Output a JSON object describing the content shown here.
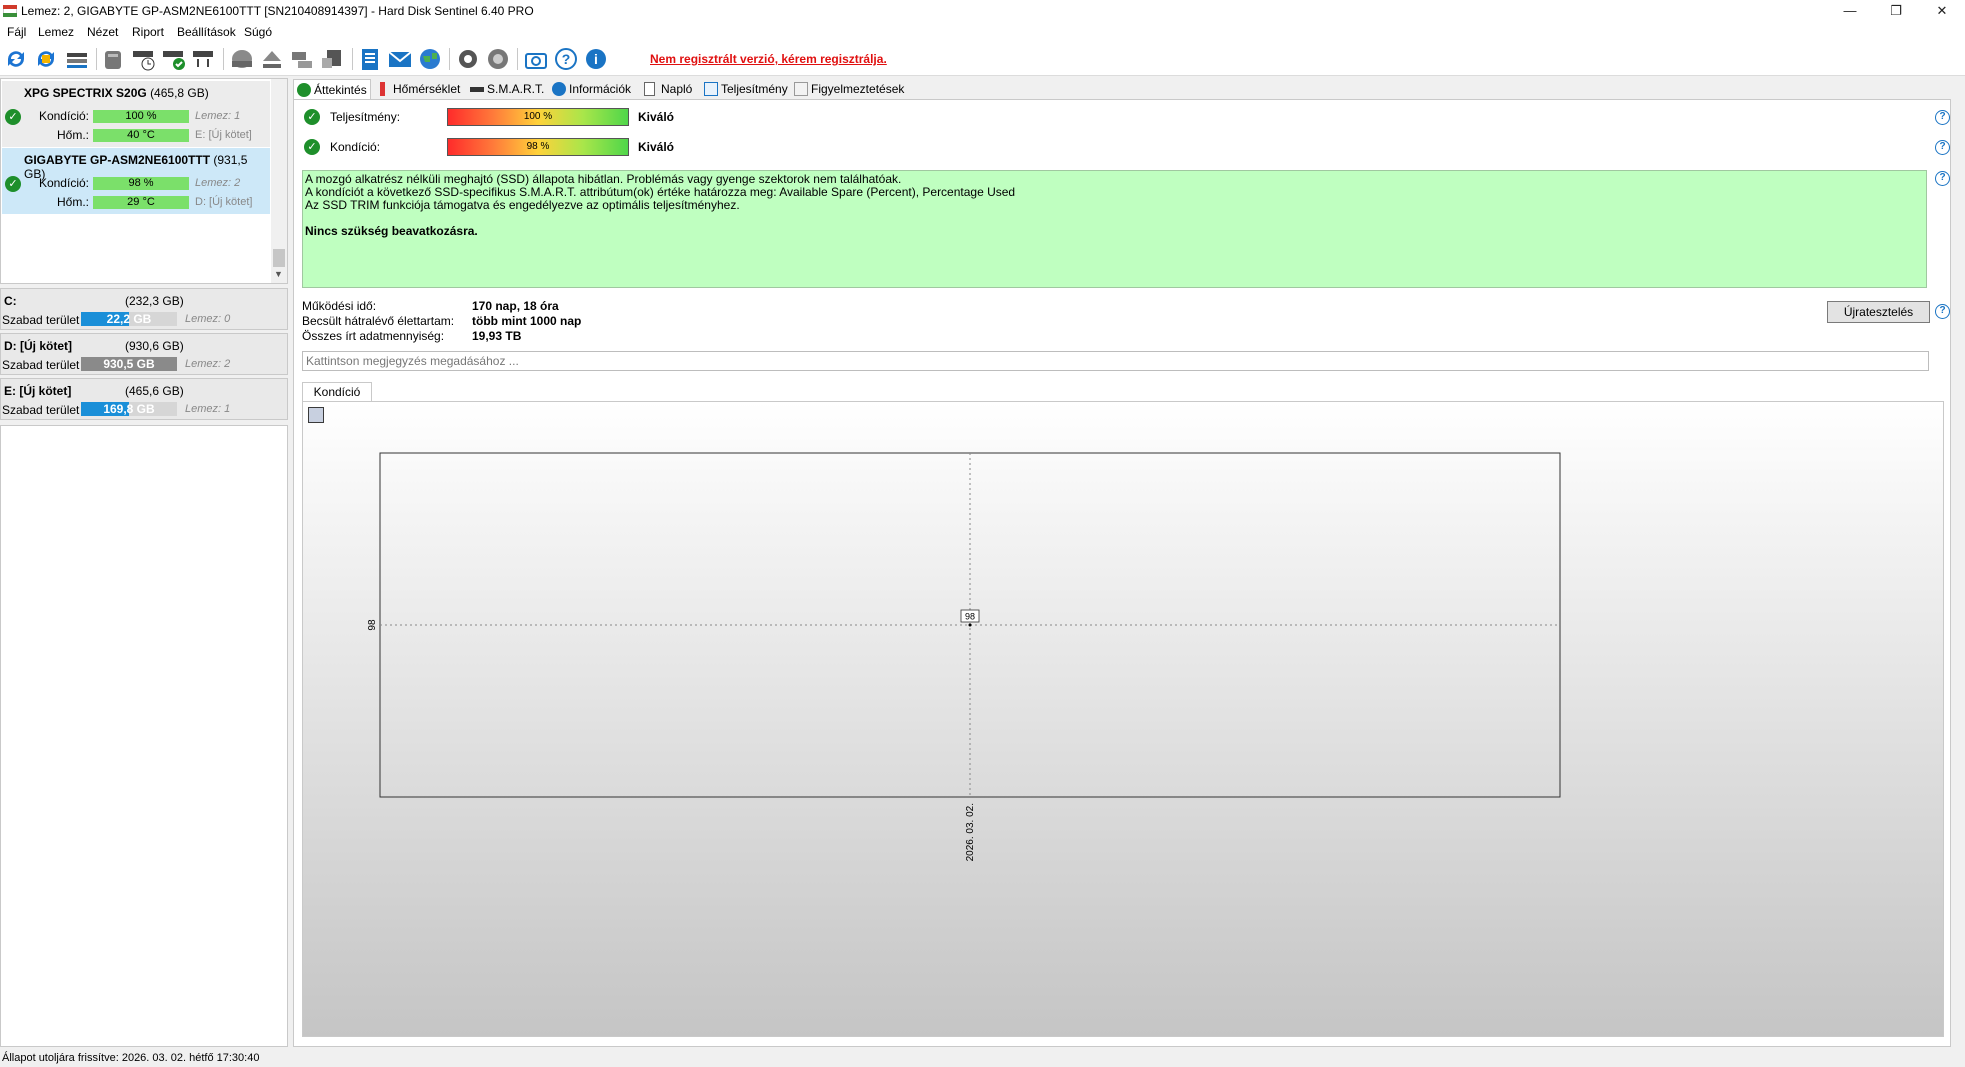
{
  "window": {
    "title": "Lemez: 2, GIGABYTE GP-ASM2NE6100TTT [SN210408914397]  -  Hard Disk Sentinel 6.40 PRO",
    "minimize": "—",
    "restore": "❐",
    "close": "✕"
  },
  "menu": [
    "Fájl",
    "Lemez",
    "Nézet",
    "Riport",
    "Beállítások",
    "Súgó"
  ],
  "toolbar": {
    "register_link": "Nem regisztrált verzió, kérem regisztrálja."
  },
  "disks": [
    {
      "name": "XPG SPECTRIX S20G",
      "size": "(465,8 GB)",
      "health_label": "Kondíció:",
      "health": "100 %",
      "health_side": "Lemez: 1",
      "temp_label": "Hőm.:",
      "temp": "40 °C",
      "temp_side": "E: [Új kötet]"
    },
    {
      "name": "GIGABYTE GP-ASM2NE6100TTT",
      "size": "(931,5 GB)",
      "health_label": "Kondíció:",
      "health": "98 %",
      "health_side": "Lemez: 2",
      "temp_label": "Hőm.:",
      "temp": "29 °C",
      "temp_side": "D: [Új kötet]"
    }
  ],
  "volumes": [
    {
      "name": "C:",
      "size": "(232,3 GB)",
      "free_label": "Szabad terület",
      "free": "22,2 GB",
      "free_fraction": 0.5,
      "color": "#1a8fd8",
      "disk": "Lemez: 0"
    },
    {
      "name": "D: [Új kötet]",
      "size": "(930,6 GB)",
      "free_label": "Szabad terület",
      "free": "930,5 GB",
      "free_fraction": 1.0,
      "color": "#8a8a8a",
      "disk": "Lemez: 2"
    },
    {
      "name": "E: [Új kötet]",
      "size": "(465,6 GB)",
      "free_label": "Szabad terület",
      "free": "169,8 GB",
      "free_fraction": 0.5,
      "color": "#1a8fd8",
      "disk": "Lemez: 1"
    }
  ],
  "tabs": [
    "Áttekintés",
    "Hőmérséklet",
    "S.M.A.R.T.",
    "Információk",
    "Napló",
    "Teljesítmény",
    "Figyelmeztetések"
  ],
  "overview": {
    "performance_label": "Teljesítmény:",
    "performance_pct": "100 %",
    "performance_value": "Kiváló",
    "health_label": "Kondíció:",
    "health_pct": "98 %",
    "health_value": "Kiváló",
    "help": "?",
    "status_lines": [
      "A mozgó alkatrész nélküli meghajtó (SSD) állapota hibátlan. Problémás vagy gyenge szektorok nem találhatóak.",
      "A kondíciót a következő SSD-specifikus S.M.A.R.T. attribútum(ok) értéke határozza meg:  Available Spare (Percent), Percentage Used",
      "Az SSD TRIM funkciója támogatva és engedélyezve az optimális teljesítményhez."
    ],
    "status_conclusion": "Nincs szükség beavatkozásra.",
    "uptime_label": "Működési idő:",
    "uptime": "170 nap, 18 óra",
    "lifetime_label": "Becsült hátralévő élettartam:",
    "lifetime": "több mint 1000 nap",
    "written_label": "Összes írt adatmennyiség:",
    "written": "19,93 TB",
    "retest_button": "Újratesztelés",
    "note_placeholder": "Kattintson megjegyzés megadásához ...",
    "chart_tab": "Kondíció  (%)"
  },
  "chart_data": {
    "type": "line",
    "x": [
      "2026. 03. 02."
    ],
    "series": [
      {
        "values": [
          98
        ]
      }
    ],
    "ytick": "98",
    "ylim": [
      97,
      99
    ],
    "grid": true
  },
  "statusbar": "Állapot utoljára frissítve: 2026. 03. 02. hétfő 17:30:40",
  "colors": {
    "ok_green": "#1e8f2b",
    "link_red": "#e01010",
    "status_bg": "#bfffc0",
    "volume_blue": "#1a8fd8"
  }
}
